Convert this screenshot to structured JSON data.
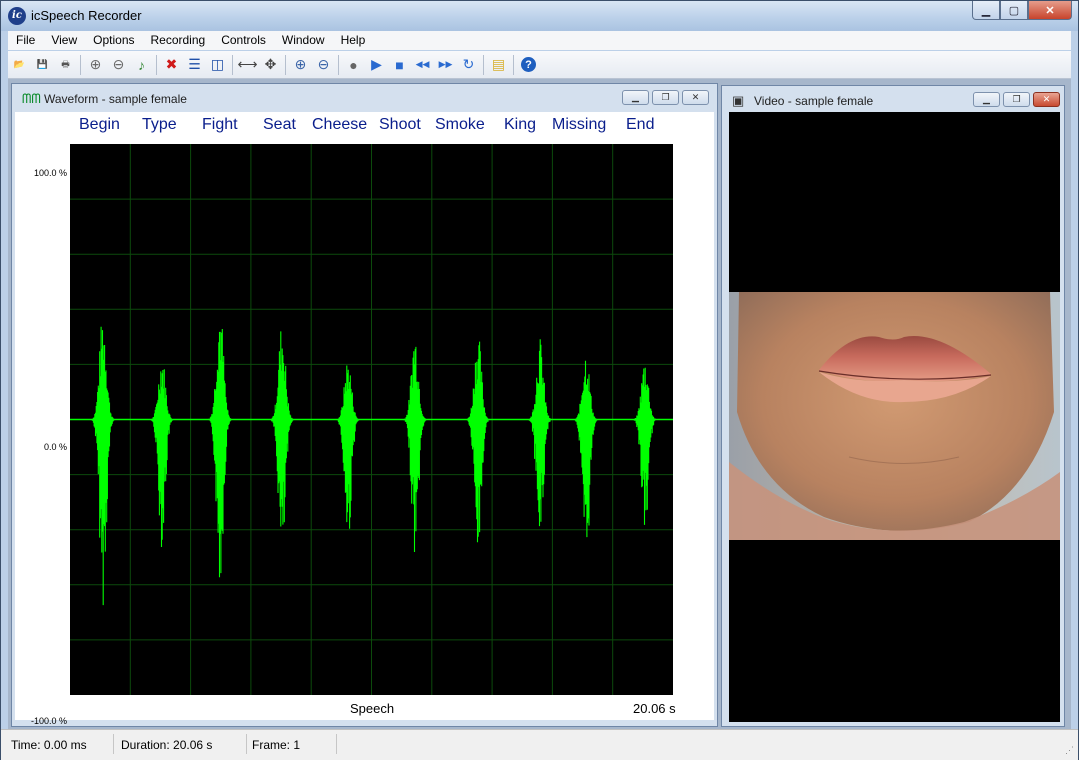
{
  "app": {
    "title": "icSpeech Recorder",
    "icon_text": "ic"
  },
  "menu": [
    "File",
    "View",
    "Options",
    "Recording",
    "Controls",
    "Window",
    "Help"
  ],
  "toolbar_icons": [
    "open-folder-icon",
    "save-icon",
    "print-icon",
    "sep",
    "add-clip-icon",
    "remove-clip-icon",
    "add-audio-icon",
    "sep",
    "delete-icon",
    "split-horizontal-icon",
    "split-vertical-icon",
    "sep",
    "fit-width-icon",
    "move-icon",
    "sep",
    "zoom-in-icon",
    "zoom-out-icon",
    "sep",
    "record-icon",
    "play-icon",
    "stop-icon",
    "rewind-icon",
    "fast-forward-icon",
    "loop-icon",
    "sep",
    "notes-icon",
    "sep",
    "help-icon"
  ],
  "waveform_window": {
    "title": "Waveform - sample female",
    "words": [
      "Begin",
      "Type",
      "Fight",
      "Seat",
      "Cheese",
      "Shoot",
      "Smoke",
      "King",
      "Missing",
      "End"
    ],
    "y_labels": {
      "top": "100.0 %",
      "mid": "0.0 %",
      "bottom": "-100.0 %"
    },
    "track_label": "Speech",
    "duration_label": "20.06 s"
  },
  "video_window": {
    "title": "Video - sample female"
  },
  "status": {
    "time": "Time: 0.00 ms",
    "duration": "Duration: 20.06 s",
    "frame": "Frame: 1"
  },
  "colors": {
    "waveform": "#00ff00",
    "grid": "#0c4a0c",
    "word_label": "#0a1e8c"
  },
  "chart_data": {
    "type": "line",
    "categories": [
      "Begin",
      "Type",
      "Fight",
      "Seat",
      "Cheese",
      "Shoot",
      "Smoke",
      "King",
      "Missing",
      "End"
    ],
    "ylabel_ticks": [
      "100.0 %",
      "0.0 %",
      "-100.0 %"
    ],
    "ylim": [
      -100,
      100
    ],
    "peaks_percent": [
      {
        "word": "Begin",
        "up": 40,
        "down": 68
      },
      {
        "word": "Type",
        "up": 24,
        "down": 47
      },
      {
        "word": "Fight",
        "up": 43,
        "down": 61
      },
      {
        "word": "Seat",
        "up": 36,
        "down": 54
      },
      {
        "word": "Cheese",
        "up": 23,
        "down": 46
      },
      {
        "word": "Shoot",
        "up": 33,
        "down": 50
      },
      {
        "word": "Smoke",
        "up": 32,
        "down": 51
      },
      {
        "word": "King",
        "up": 30,
        "down": 47
      },
      {
        "word": "Missing",
        "up": 26,
        "down": 57
      },
      {
        "word": "End",
        "up": 23,
        "down": 43
      }
    ],
    "x_end": "20.06 s",
    "grid": true
  }
}
